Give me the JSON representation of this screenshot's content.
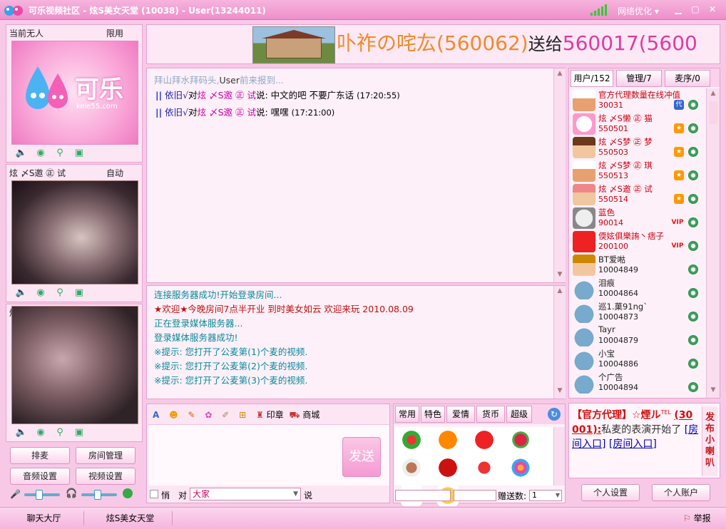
{
  "window": {
    "title": "可乐视频社区 - 炫S美女天堂 (10038) - User(13244011)",
    "network_label": "网络优化",
    "minimize": "▁",
    "restore": "▢",
    "close": "✕"
  },
  "left": {
    "mic1_left": "当前无人",
    "mic1_right": "限用",
    "logo_text": "可乐",
    "logo_url": "kele55.com",
    "mic2_left": "炫 〆S邀 ㊣ 试",
    "mic2_right": "自动",
    "mic3_left": "炫",
    "buttons": {
      "queue": "排麦",
      "room_manage": "房间管理",
      "audio_settings": "音频设置",
      "video_settings": "视频设置"
    }
  },
  "banner": {
    "text_part1": "卟祚の咤厷(560062)",
    "text_part2": "送给",
    "text_part3": "560017(5600"
  },
  "public_chat": {
    "welcome": "拜山拜水拜码头,",
    "welcome_user": "User",
    "welcome_tail": "前来报到...",
    "messages": [
      {
        "from": "依旧√",
        "to_word": "对",
        "target": "炫 〆S邀 ㊣ 试",
        "say_word": "说:",
        "text": "中文的吧 不要广东话",
        "time": "(17:20:55)"
      },
      {
        "from": "依旧√",
        "to_word": "对",
        "target": "炫 〆S邀 ㊣ 试",
        "say_word": "说:",
        "text": "嘿嘿",
        "time": "(17:21:00)"
      }
    ]
  },
  "system_log": {
    "lines": [
      "连接服务器成功!开始登录房间...",
      "★欢迎★今晚房间7点半开业 到时美女如云 欢迎来玩 2010.08.09",
      "正在登录媒体服务器...",
      "登录媒体服务器成功!",
      "※提示: 您打开了公麦第(1)个麦的视频.",
      "※提示: 您打开了公麦第(2)个麦的视频.",
      "※提示: 您打开了公麦第(3)个麦的视频."
    ]
  },
  "input": {
    "stamp_label": "印章",
    "mall_label": "商城",
    "send_label": "发送",
    "private_label": "悄",
    "to_label": "对",
    "target_value": "大家",
    "say_label": "说"
  },
  "gifts": {
    "tabs": [
      "常用",
      "特色",
      "爱情",
      "货币",
      "超级"
    ],
    "count_label": "赠送数:",
    "count_value": "1"
  },
  "users": {
    "tabs": [
      "用户/152",
      "管理/7",
      "麦序/0"
    ],
    "list": [
      {
        "name": "官方代理数量在线冲值",
        "id": "30031"
      },
      {
        "name": "炫 〆S懒 ㊣ 猫",
        "id": "550501"
      },
      {
        "name": "炫 〆S梦 ㊣ 梦",
        "id": "550503"
      },
      {
        "name": "炫 〆S梦 ㊣ 琪",
        "id": "550513"
      },
      {
        "name": "炫 〆S邀 ㊣ 试",
        "id": "550514"
      },
      {
        "name": "蓝色",
        "id": "90014"
      },
      {
        "name": "偄妶俱樂詴丶痞子",
        "id": "200100"
      },
      {
        "name": "BT爱喖",
        "id": "10004849"
      },
      {
        "name": "泪痕",
        "id": "10004864"
      },
      {
        "name": "巡1.菓91ng`",
        "id": "10004873"
      },
      {
        "name": "Tayr",
        "id": "10004879"
      },
      {
        "name": "小宝",
        "id": "10004886"
      },
      {
        "name": "个广告",
        "id": "10004894"
      }
    ]
  },
  "broadcast": {
    "sender": "【官方代理】☆煙ル",
    "sender_sup": "TEL",
    "sender_id": "(30001):",
    "text": "私麦的表演开始了",
    "link1": "[房间入口]",
    "link2": "[房间入口]",
    "side_label": "发布小喇叭"
  },
  "account": {
    "personal_settings": "个人设置",
    "personal_account": "个人账户"
  },
  "statusbar": {
    "tab1": "聊天大厅",
    "tab2": "炫S美女天堂",
    "report": "举报"
  }
}
